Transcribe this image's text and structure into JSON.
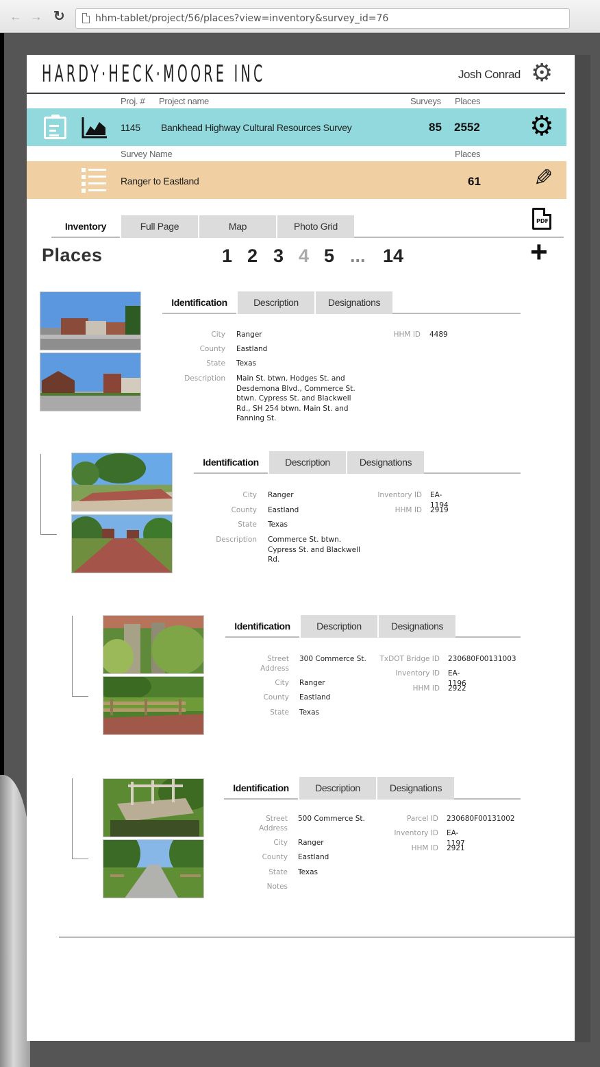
{
  "browser": {
    "back_glyph": "←",
    "forward_glyph": "→",
    "reload_glyph": "↻",
    "url": "hhm-tablet/project/56/places?view=inventory&survey_id=76"
  },
  "header": {
    "logo": "HARDY·HECK·MOORE INC",
    "user_name": "Josh Conrad"
  },
  "project": {
    "labels": {
      "proj_no": "Proj. #",
      "name": "Project name",
      "surveys": "Surveys",
      "places": "Places"
    },
    "number": "1145",
    "name": "Bankhead Highway Cultural Resources Survey",
    "surveys": "85",
    "places": "2552",
    "color": "#91d9dd"
  },
  "survey": {
    "labels": {
      "name": "Survey Name",
      "places": "Places"
    },
    "name": "Ranger to Eastland",
    "places": "61",
    "color": "#f0d0a2"
  },
  "view_tabs": [
    "Inventory",
    "Full Page",
    "Map",
    "Photo Grid"
  ],
  "places_heading": "Places",
  "pagination": {
    "pages": [
      "1",
      "2",
      "3",
      "4",
      "5",
      "...",
      "14"
    ],
    "current": "4"
  },
  "place_tabs": [
    "Identification",
    "Description",
    "Designations"
  ],
  "places": [
    {
      "left_fields": [
        {
          "key": "City",
          "value": "Ranger"
        },
        {
          "key": "County",
          "value": "Eastland"
        },
        {
          "key": "State",
          "value": "Texas"
        },
        {
          "key": "Description",
          "value": "Main St. btwn. Hodges St. and Desdemona Blvd., Commerce St. btwn. Cypress St. and Blackwell Rd., SH 254 btwn. Main St. and Fanning St."
        }
      ],
      "right_fields": [
        {
          "key": "HHM ID",
          "value": "4489"
        }
      ]
    },
    {
      "left_fields": [
        {
          "key": "City",
          "value": "Ranger"
        },
        {
          "key": "County",
          "value": "Eastland"
        },
        {
          "key": "State",
          "value": "Texas"
        },
        {
          "key": "Description",
          "value": "Commerce St. btwn. Cypress St. and Blackwell Rd."
        }
      ],
      "right_fields": [
        {
          "key": "Inventory ID",
          "value": "EA-1194"
        },
        {
          "key": "HHM ID",
          "value": "2919"
        }
      ]
    },
    {
      "left_fields": [
        {
          "key": "Street Address",
          "value": "300 Commerce St."
        },
        {
          "key": "City",
          "value": "Ranger"
        },
        {
          "key": "County",
          "value": "Eastland"
        },
        {
          "key": "State",
          "value": "Texas"
        }
      ],
      "right_fields": [
        {
          "key": "TxDOT Bridge ID",
          "value": "230680F00131003"
        },
        {
          "key": "Inventory ID",
          "value": "EA-1196"
        },
        {
          "key": "HHM ID",
          "value": "2922"
        }
      ]
    },
    {
      "left_fields": [
        {
          "key": "Street Address",
          "value": "500 Commerce St."
        },
        {
          "key": "City",
          "value": "Ranger"
        },
        {
          "key": "County",
          "value": "Eastland"
        },
        {
          "key": "State",
          "value": "Texas"
        },
        {
          "key": "Notes",
          "value": ""
        }
      ],
      "right_fields": [
        {
          "key": "Parcel ID",
          "value": "230680F00131002"
        },
        {
          "key": "Inventory ID",
          "value": "EA-1197"
        },
        {
          "key": "HHM ID",
          "value": "2921"
        }
      ]
    }
  ]
}
